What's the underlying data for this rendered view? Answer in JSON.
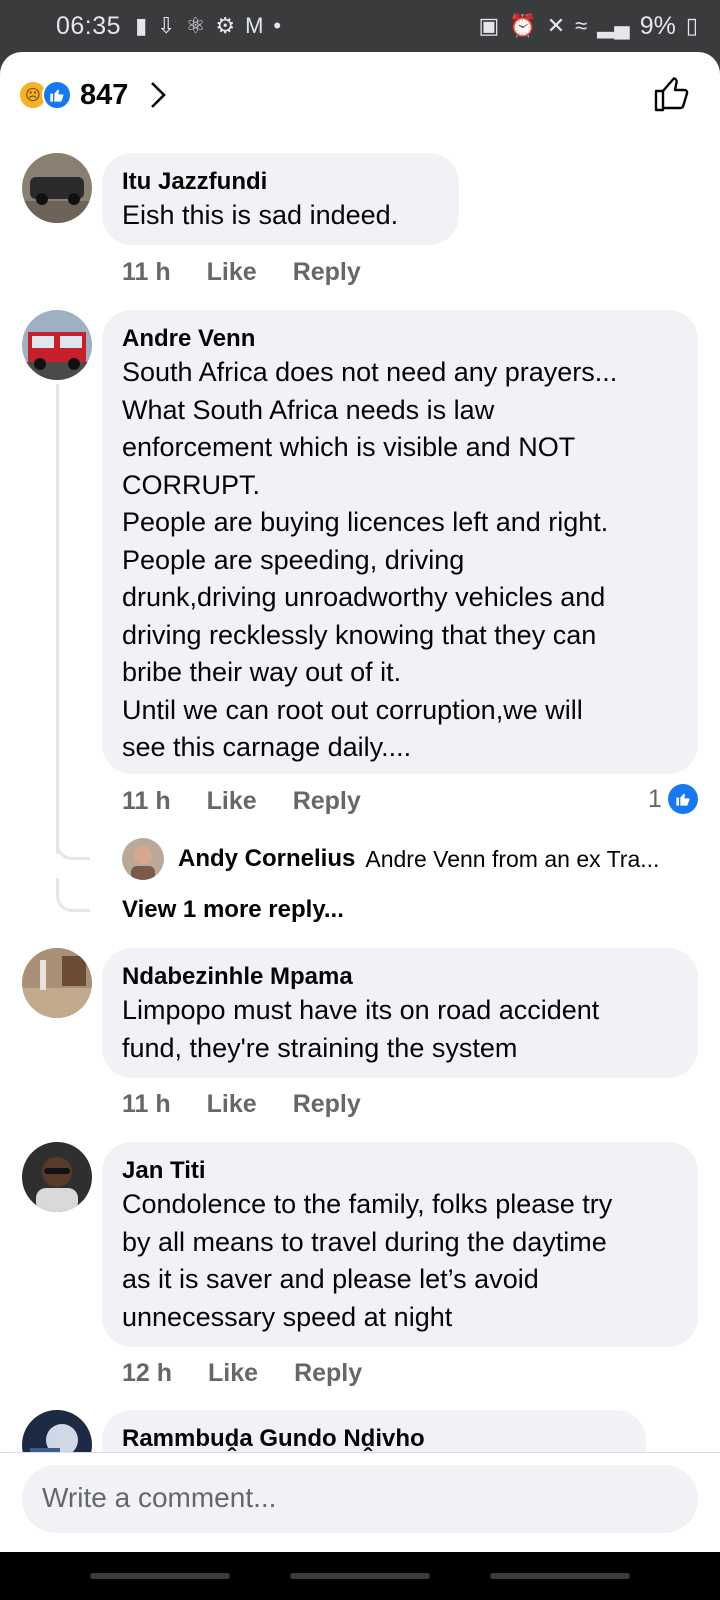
{
  "status_bar": {
    "time": "06:35",
    "left_icons": [
      "message-icon",
      "download-icon",
      "notification-icon",
      "settings-icon",
      "mail-icon",
      "dot-icon"
    ],
    "right_icons": [
      "battery-saver-icon",
      "alarm-icon",
      "mute-icon",
      "wifi-icon",
      "signal-icon"
    ],
    "battery": "9%"
  },
  "reactions": {
    "count": "847",
    "icons": [
      "sad-emoji-icon",
      "like-icon"
    ]
  },
  "comments": [
    {
      "author": "Itu Jazzfundi",
      "text": "Eish this is sad indeed.",
      "time": "11 h",
      "like_label": "Like",
      "reply_label": "Reply"
    },
    {
      "author": "Andre Venn",
      "lines": [
        "South Africa does not need any prayers...",
        "What South Africa needs is law",
        "enforcement which is visible and NOT",
        "CORRUPT.",
        "People are buying licences left and right.",
        "People are speeding, driving",
        "drunk,driving unroadworthy vehicles and",
        "driving recklessly knowing that they can",
        "bribe their way out of it.",
        "Until we can root out corruption,we will",
        "see this carnage daily...."
      ],
      "time": "11 h",
      "like_label": "Like",
      "reply_label": "Reply",
      "like_count": "1",
      "reply_preview": {
        "author": "Andy Cornelius",
        "text": "Andre Venn from an ex Tra..."
      },
      "view_more": "View 1 more reply..."
    },
    {
      "author": "Ndabezinhle Mpama",
      "lines": [
        "Limpopo must have its on road accident",
        "fund, they're straining the system"
      ],
      "time": "11 h",
      "like_label": "Like",
      "reply_label": "Reply"
    },
    {
      "author": "Jan Titi",
      "lines": [
        "Condolence to the family, folks please try",
        "by all means to travel during the daytime",
        "as it is saver and please let’s avoid",
        "unnecessary speed at night"
      ],
      "time": "12 h",
      "like_label": "Like",
      "reply_label": "Reply"
    },
    {
      "author": "Rammbuḓa Gundo Nḓivho"
    }
  ],
  "composer": {
    "placeholder": "Write a comment..."
  },
  "colors": {
    "facebook_blue": "#1877f2",
    "bubble": "#f0f2f5",
    "meta_text": "#65676b"
  }
}
